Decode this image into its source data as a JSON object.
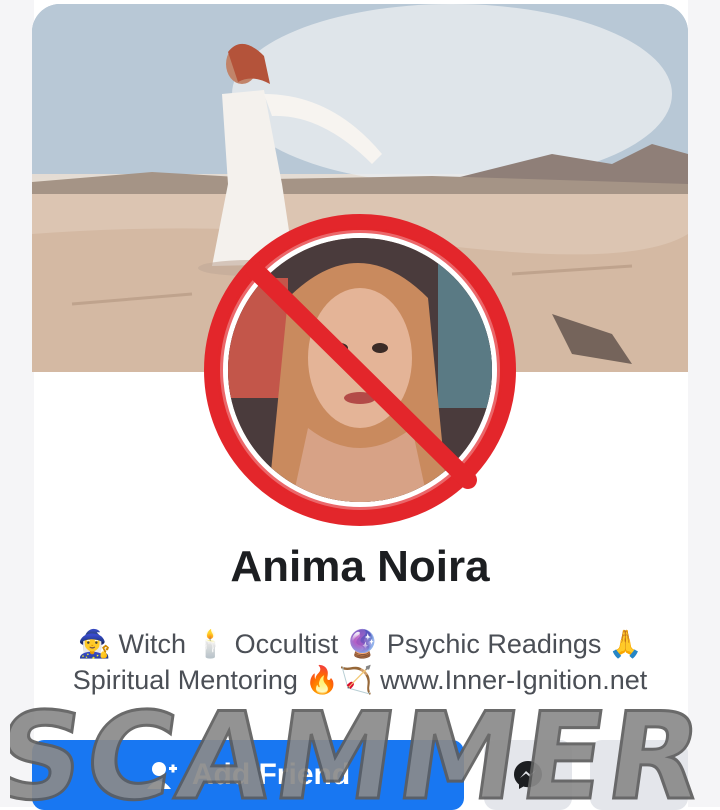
{
  "profile": {
    "name": "Anima Noira",
    "bio_line1": "🧙‍♀️ Witch 🕯️ Occultist 🔮 Psychic Readings 🙏",
    "bio_line2": "Spiritual Mentoring 🔥🏹 www.Inner-Ignition.net"
  },
  "actions": {
    "add_friend_label": "Add Friend",
    "add_friend_icon": "person-add-icon",
    "messenger_icon": "messenger-icon"
  },
  "overlay": {
    "stamp_text": "SCAMMER",
    "stamp_color": "#8a8a8a",
    "no_sign_color": "#e3262b"
  },
  "colors": {
    "primary": "#1877f2",
    "secondary_button": "#e4e6eb",
    "text": "#1c1e21",
    "muted_text": "#4b4f56"
  }
}
